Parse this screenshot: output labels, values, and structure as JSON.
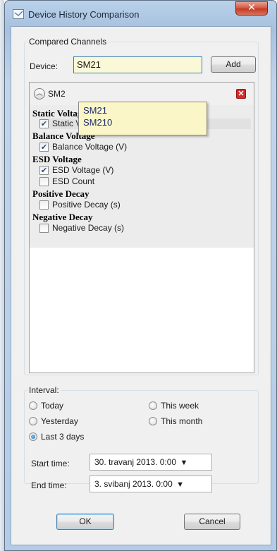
{
  "window": {
    "title": "Device History Comparison",
    "close_glyph": "✕"
  },
  "compared_channels": {
    "legend": "Compared Channels",
    "device_label": "Device:",
    "device_value": "SM21",
    "add_label": "Add",
    "suggestions": [
      "SM21",
      "SM210"
    ],
    "channel": {
      "name": "SM2",
      "categories": [
        {
          "title": "Static Voltage",
          "items": [
            {
              "label": "Static Voltage (V)",
              "checked": true
            }
          ]
        },
        {
          "title": "Balance Voltage",
          "items": [
            {
              "label": "Balance Voltage (V)",
              "checked": true
            }
          ]
        },
        {
          "title": "ESD Voltage",
          "items": [
            {
              "label": "ESD Voltage (V)",
              "checked": true
            },
            {
              "label": "ESD Count",
              "checked": false
            }
          ]
        },
        {
          "title": "Positive Decay",
          "items": [
            {
              "label": "Positive Decay (s)",
              "checked": false
            }
          ]
        },
        {
          "title": "Negative Decay",
          "items": [
            {
              "label": "Negative Decay (s)",
              "checked": false
            }
          ]
        }
      ]
    }
  },
  "interval": {
    "legend": "Interval:",
    "options": {
      "today": "Today",
      "yesterday": "Yesterday",
      "last3": "Last 3 days",
      "this_week": "This week",
      "this_month": "This month"
    },
    "selected": "last3",
    "start_label": "Start time:",
    "start_value": "30. travanj 2013. 0:00",
    "end_label": "End time:",
    "end_value": "3. svibanj 2013. 0:00",
    "dropdown_glyph": "▼"
  },
  "buttons": {
    "ok": "OK",
    "cancel": "Cancel"
  },
  "colors": {
    "focus_field": "#fbf8d8",
    "suggestion_bg": "#fbf6c8",
    "remove_red": "#d42a2a"
  }
}
